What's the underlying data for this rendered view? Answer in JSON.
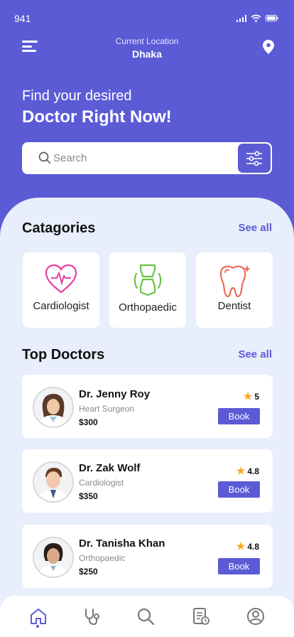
{
  "status": {
    "time": "941"
  },
  "location": {
    "label": "Current Location",
    "city": "Dhaka"
  },
  "hero": {
    "line1": "Find your desired",
    "line2": "Doctor Right Now!"
  },
  "search": {
    "placeholder": "Search"
  },
  "categories": {
    "title": "Catagories",
    "see_all": "See all",
    "items": [
      {
        "label": "Cardiologist",
        "icon": "heart-pulse-icon"
      },
      {
        "label": "Orthopaedic",
        "icon": "bone-joint-icon"
      },
      {
        "label": "Dentist",
        "icon": "tooth-icon"
      }
    ]
  },
  "doctors": {
    "title": "Top Doctors",
    "see_all": "See all",
    "items": [
      {
        "name": "Dr. Jenny Roy",
        "specialty": "Heart Surgeon",
        "price": "$300",
        "rating": "5",
        "book_label": "Book"
      },
      {
        "name": "Dr. Zak Wolf",
        "specialty": "Cardiologist",
        "price": "$350",
        "rating": "4.8",
        "book_label": "Book"
      },
      {
        "name": "Dr. Tanisha Khan",
        "specialty": "Orthopaedic",
        "price": "$250",
        "rating": "4.8",
        "book_label": "Book"
      }
    ]
  },
  "nav": {
    "items": [
      {
        "icon": "home-icon"
      },
      {
        "icon": "stethoscope-icon"
      },
      {
        "icon": "search-icon"
      },
      {
        "icon": "records-icon"
      },
      {
        "icon": "profile-icon"
      }
    ]
  },
  "colors": {
    "primary": "#5b5bd6",
    "background": "#e8eefb",
    "star": "#f5a623",
    "heart": "#e83fa3",
    "bone": "#6cc24a",
    "tooth": "#f06a5a"
  }
}
